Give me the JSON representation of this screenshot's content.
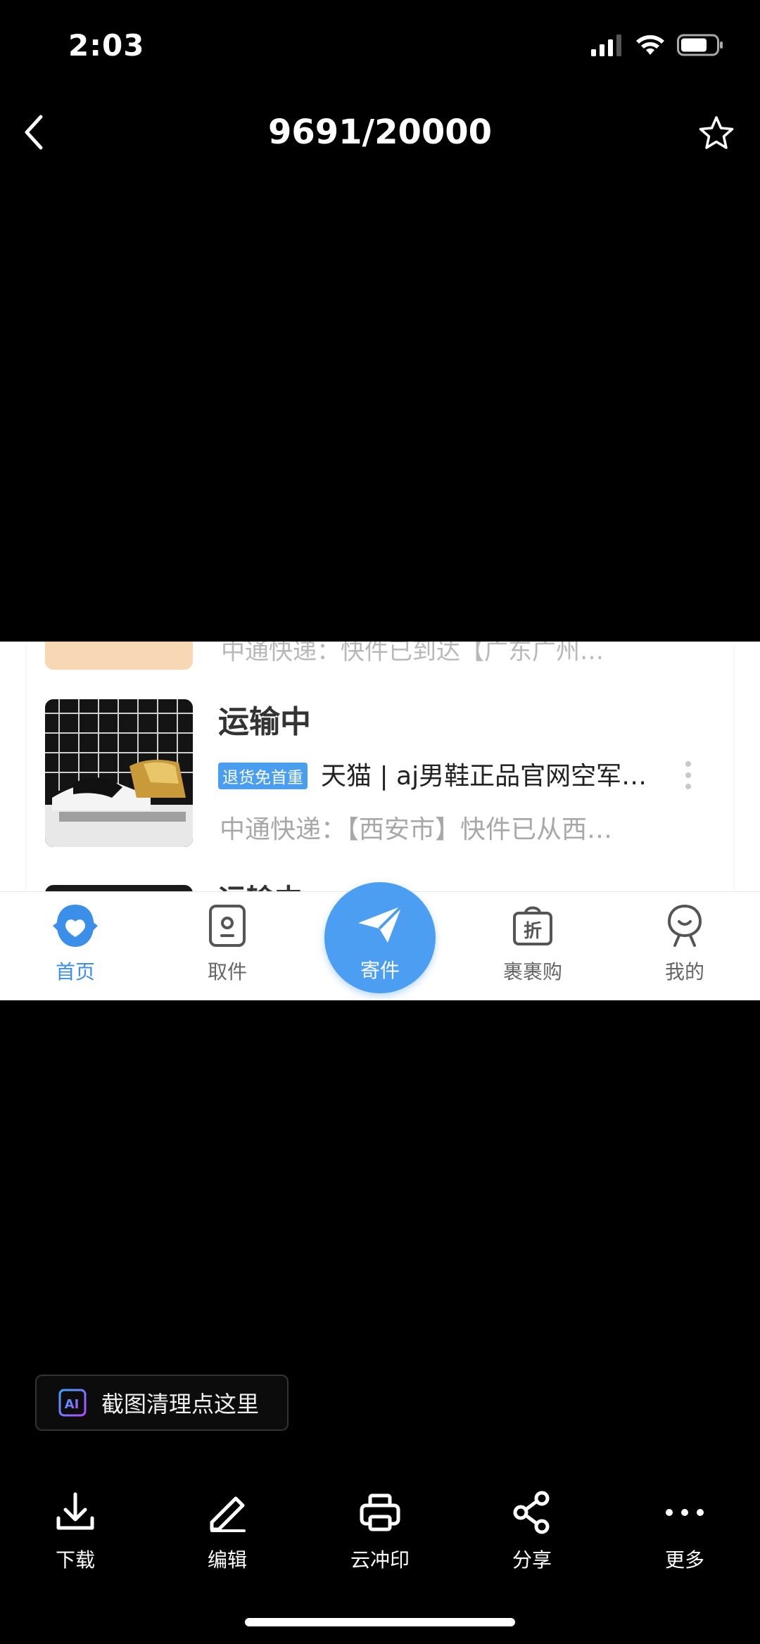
{
  "status_bar": {
    "time": "2:03"
  },
  "header": {
    "counter": "9691/20000"
  },
  "screenshot": {
    "prev_item_sub": "中通快递：快件已到达【广东广州…",
    "item": {
      "status": "运输中",
      "badge": "退货免首重",
      "title": "天猫 | aj男鞋正品官网空军…",
      "sub": "中通快递：【西安市】快件已从西…"
    },
    "next_item_status": "运输中",
    "tabbar": {
      "tabs": [
        {
          "label": "首页"
        },
        {
          "label": "取件"
        },
        {
          "label": "寄件"
        },
        {
          "label": "裹裹购"
        },
        {
          "label": "我的"
        }
      ],
      "accent": "#3b8fe8"
    }
  },
  "cleanup_hint": {
    "label": "截图清理点这里"
  },
  "toolbar": {
    "items": [
      {
        "label": "下载"
      },
      {
        "label": "编辑"
      },
      {
        "label": "云冲印"
      },
      {
        "label": "分享"
      },
      {
        "label": "更多"
      }
    ]
  }
}
